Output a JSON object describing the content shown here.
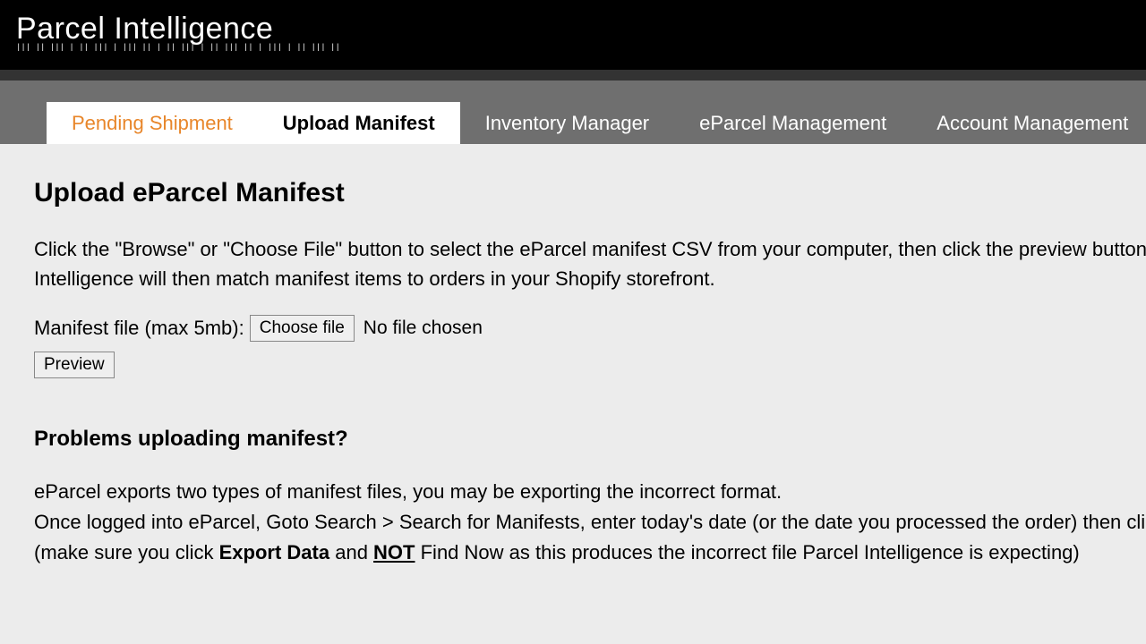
{
  "brand": {
    "name": "Parcel Intelligence",
    "barcode": "||| || ||| | || ||| | ||| || | || ||| | || ||| || | ||| | || ||| ||"
  },
  "nav": {
    "tabs": [
      {
        "label": "Pending Shipment",
        "active": true,
        "style": "orange"
      },
      {
        "label": "Upload Manifest",
        "active": true,
        "style": "black"
      },
      {
        "label": "Inventory Manager",
        "active": false
      },
      {
        "label": "eParcel Management",
        "active": false
      },
      {
        "label": "Account Management",
        "active": false
      }
    ]
  },
  "page": {
    "heading": "Upload eParcel Manifest",
    "intro": "Click the \"Browse\" or \"Choose File\" button to select the eParcel manifest CSV from your computer, then click the preview button. Parcel Intelligence will then match manifest items to orders in your Shopify storefront.",
    "file_label": "Manifest file (max 5mb):",
    "choose_label": "Choose file",
    "no_file": "No file chosen",
    "preview_label": "Preview",
    "help_heading": "Problems uploading manifest?",
    "help_line1": "eParcel exports two types of manifest files, you may be exporting the incorrect format.",
    "help_line2a": "Once logged into eParcel, Goto Search > Search for Manifests, enter today's date (or the date you processed the order) then click Export Data.",
    "help_line3a": "(make sure you click ",
    "help_bold": "Export Data",
    "help_line3b": " and ",
    "help_underline": "NOT",
    "help_line3c": " Find Now as this produces the incorrect file Parcel Intelligence is expecting)"
  }
}
